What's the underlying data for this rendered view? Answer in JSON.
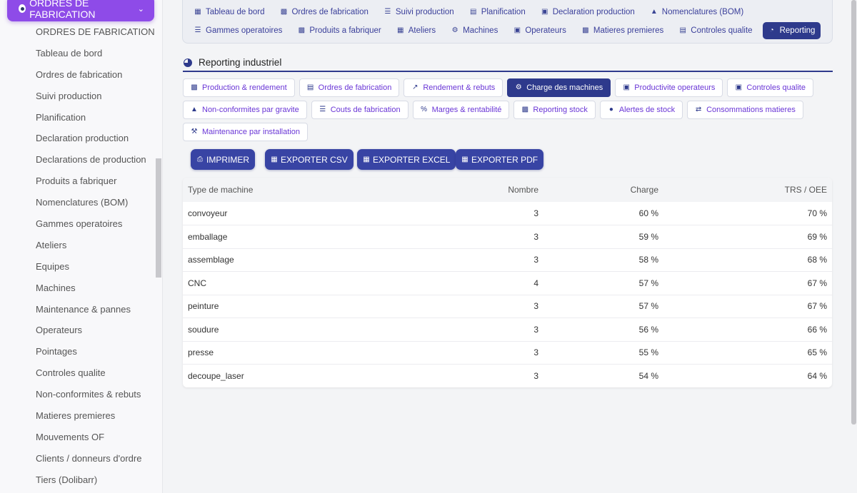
{
  "sidebar": {
    "header": "ORDRES DE FABRICATION",
    "items": [
      "ORDRES DE FABRICATION",
      "Tableau de bord",
      "Ordres de fabrication",
      "Suivi production",
      "Planification",
      "Declaration production",
      "Declarations de production",
      "Produits a fabriquer",
      "Nomenclatures (BOM)",
      "Gammes operatoires",
      "Ateliers",
      "Equipes",
      "Machines",
      "Maintenance & pannes",
      "Operateurs",
      "Pointages",
      "Controles qualite",
      "Non-conformites & rebuts",
      "Matieres premieres",
      "Mouvements OF",
      "Clients / donneurs d'ordre",
      "Tiers (Dolibarr)"
    ]
  },
  "topnav": {
    "row1": [
      {
        "label": "Tableau de bord",
        "icon": "grid-icon"
      },
      {
        "label": "Ordres de fabrication",
        "icon": "factory-icon"
      },
      {
        "label": "Suivi production",
        "icon": "list-icon"
      },
      {
        "label": "Planification",
        "icon": "calendar-icon"
      },
      {
        "label": "Declaration production",
        "icon": "clipboard-check-icon"
      },
      {
        "label": "Nomenclatures (BOM)",
        "icon": "sitemap-icon"
      }
    ],
    "row2": [
      {
        "label": "Gammes operatoires",
        "icon": "list-icon"
      },
      {
        "label": "Produits a fabriquer",
        "icon": "box-icon"
      },
      {
        "label": "Ateliers",
        "icon": "building-icon"
      },
      {
        "label": "Machines",
        "icon": "cogs-icon"
      },
      {
        "label": "Operateurs",
        "icon": "id-badge-icon"
      },
      {
        "label": "Matieres premieres",
        "icon": "cubes-icon"
      },
      {
        "label": "Controles qualite",
        "icon": "clipboard-icon"
      },
      {
        "label": "Reporting",
        "icon": "pie-chart-icon",
        "active": true
      }
    ]
  },
  "reporting": {
    "title": "Reporting industriel",
    "tabs_row1": [
      {
        "label": "Production & rendement",
        "icon": "factory-icon"
      },
      {
        "label": "Ordres de fabrication",
        "icon": "clipboard-icon"
      },
      {
        "label": "Rendement & rebuts",
        "icon": "line-chart-icon"
      },
      {
        "label": "Charge des machines",
        "icon": "cogs-icon",
        "active": true
      },
      {
        "label": "Productivite operateurs",
        "icon": "id-badge-icon"
      },
      {
        "label": "Controles qualite",
        "icon": "clipboard-check-icon"
      }
    ],
    "tabs_row2": [
      {
        "label": "Non-conformites par gravite",
        "icon": "warning-icon"
      },
      {
        "label": "Couts de fabrication",
        "icon": "coins-icon"
      },
      {
        "label": "Marges & rentabilité",
        "icon": "percent-icon"
      },
      {
        "label": "Reporting stock",
        "icon": "cubes-icon"
      },
      {
        "label": "Alertes de stock",
        "icon": "alert-circle-icon"
      },
      {
        "label": "Consommations matieres",
        "icon": "exchange-icon"
      }
    ],
    "tabs_row3": [
      {
        "label": "Maintenance par installation",
        "icon": "wrench-icon"
      }
    ],
    "export": {
      "print": "IMPRIMER",
      "csv": "EXPORTER CSV",
      "excel": "EXPORTER EXCEL",
      "pdf": "EXPORTER PDF"
    }
  },
  "table": {
    "headers": {
      "type": "Type de machine",
      "count": "Nombre",
      "load": "Charge",
      "oee": "TRS / OEE"
    },
    "rows": [
      {
        "type": "convoyeur",
        "count": "3",
        "load": "60 %",
        "oee": "70 %"
      },
      {
        "type": "emballage",
        "count": "3",
        "load": "59 %",
        "oee": "69 %"
      },
      {
        "type": "assemblage",
        "count": "3",
        "load": "58 %",
        "oee": "68 %"
      },
      {
        "type": "CNC",
        "count": "4",
        "load": "57 %",
        "oee": "67 %"
      },
      {
        "type": "peinture",
        "count": "3",
        "load": "57 %",
        "oee": "67 %"
      },
      {
        "type": "soudure",
        "count": "3",
        "load": "56 %",
        "oee": "66 %"
      },
      {
        "type": "presse",
        "count": "3",
        "load": "55 %",
        "oee": "65 %"
      },
      {
        "type": "decoupe_laser",
        "count": "3",
        "load": "54 %",
        "oee": "64 %"
      }
    ]
  },
  "colors": {
    "primary": "#2e3a8c",
    "accent": "#8e4be8",
    "link": "#6a36d6"
  }
}
